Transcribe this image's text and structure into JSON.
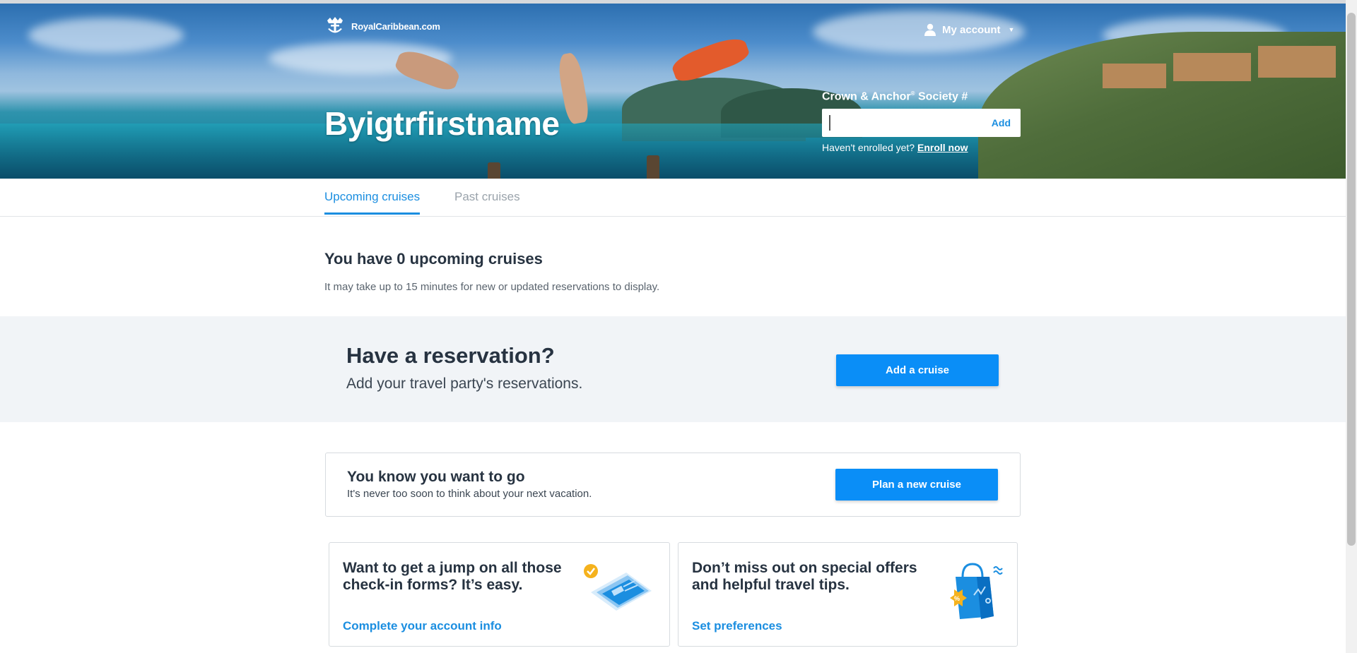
{
  "header": {
    "logo_text": "RoyalCaribbean.com",
    "account_label": "My account",
    "user_name": "Byigtrfirstname"
  },
  "crown_anchor": {
    "label_main": "Crown & Anchor",
    "label_reg": "®",
    "label_suffix": " Society #",
    "input_value": "",
    "add_label": "Add",
    "enroll_prompt": "Haven't enrolled yet? ",
    "enroll_link": "Enroll now"
  },
  "tabs": [
    {
      "label": "Upcoming cruises",
      "active": true
    },
    {
      "label": "Past cruises",
      "active": false
    }
  ],
  "upcoming": {
    "title": "You have 0 upcoming cruises",
    "subtitle": "It may take up to 15 minutes for new or updated reservations to display."
  },
  "reservation": {
    "title": "Have a reservation?",
    "subtitle": "Add your travel party's reservations.",
    "button": "Add a cruise"
  },
  "plan": {
    "title": "You know you want to go",
    "subtitle": "It's never too soon to think about your next vacation.",
    "button": "Plan a new cruise"
  },
  "cards": [
    {
      "title_line1": "Want to get a jump on all those",
      "title_line2": "check-in forms? It’s easy.",
      "link": "Complete your account info",
      "icon": "id-card-checkmark-icon"
    },
    {
      "title_line1": "Don’t miss out on special offers",
      "title_line2": "and helpful travel tips.",
      "link": "Set preferences",
      "icon": "shopping-bag-offers-icon"
    }
  ],
  "colors": {
    "accent_blue": "#1b8ee0",
    "button_blue": "#0a8ef7",
    "band_bg": "#f1f4f7"
  }
}
